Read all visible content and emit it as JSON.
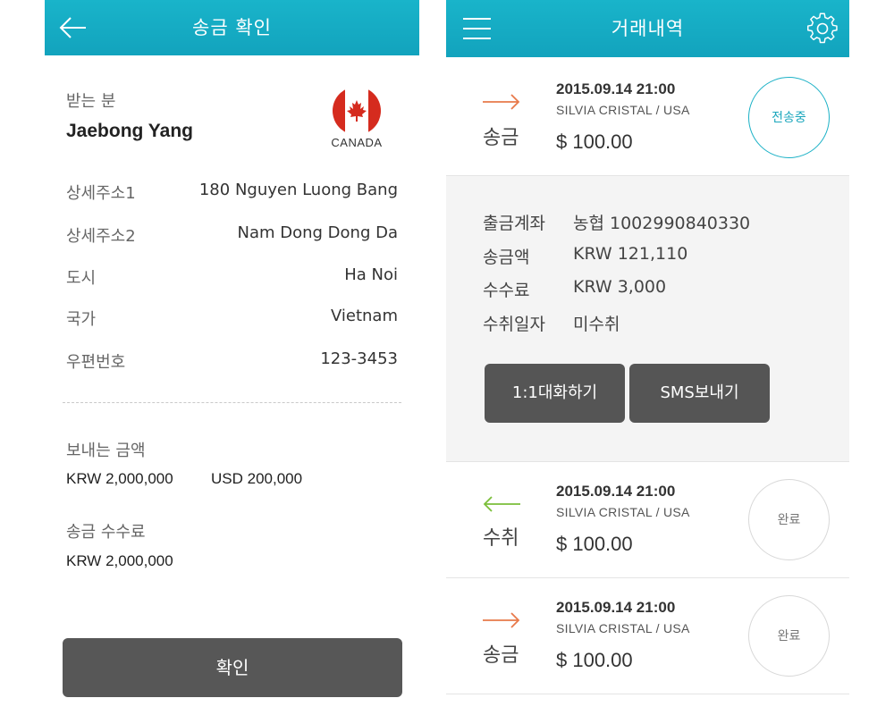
{
  "left": {
    "header_title": "송금 확인",
    "recipient_label": "받는 분",
    "recipient_name": "Jaebong Yang",
    "country_label": "CANADA",
    "address": [
      {
        "label": "상세주소1",
        "value": "180 Nguyen Luong Bang"
      },
      {
        "label": "상세주소2",
        "value": "Nam Dong Dong Da"
      },
      {
        "label": "도시",
        "value": "Ha Noi"
      },
      {
        "label": "국가",
        "value": "Vietnam"
      },
      {
        "label": "우편번호",
        "value": "123-3453"
      }
    ],
    "send_amount_label": "보내는 금액",
    "send_amount_krw": "KRW 2,000,000",
    "send_amount_usd": "USD 200,000",
    "fee_label": "송금 수수료",
    "fee_value": "KRW 2,000,000",
    "confirm_button": "확인"
  },
  "right": {
    "header_title": "거래내역",
    "transactions": [
      {
        "type": "송금",
        "datetime": "2015.09.14 21:00",
        "counterparty": "SILVIA CRISTAL / USA",
        "amount": "$ 100.00",
        "status": "전송중"
      },
      {
        "type": "수취",
        "datetime": "2015.09.14 21:00",
        "counterparty": "SILVIA CRISTAL / USA",
        "amount": "$ 100.00",
        "status": "완료"
      },
      {
        "type": "송금",
        "datetime": "2015.09.14 21:00",
        "counterparty": "SILVIA CRISTAL / USA",
        "amount": "$ 100.00",
        "status": "완료"
      }
    ],
    "detail": [
      {
        "label": "출금계좌",
        "value": "농협 1002990840330"
      },
      {
        "label": "송금액",
        "value": "KRW 121,110"
      },
      {
        "label": "수수료",
        "value": "KRW 3,000"
      },
      {
        "label": "수취일자",
        "value": "미수취"
      }
    ],
    "chat_button": "1:1대화하기",
    "sms_button": "SMS보내기"
  },
  "colors": {
    "header": "#14a9c2",
    "send_arrow": "#e8794a",
    "receive_arrow": "#7bbf3a",
    "button": "#555555"
  }
}
